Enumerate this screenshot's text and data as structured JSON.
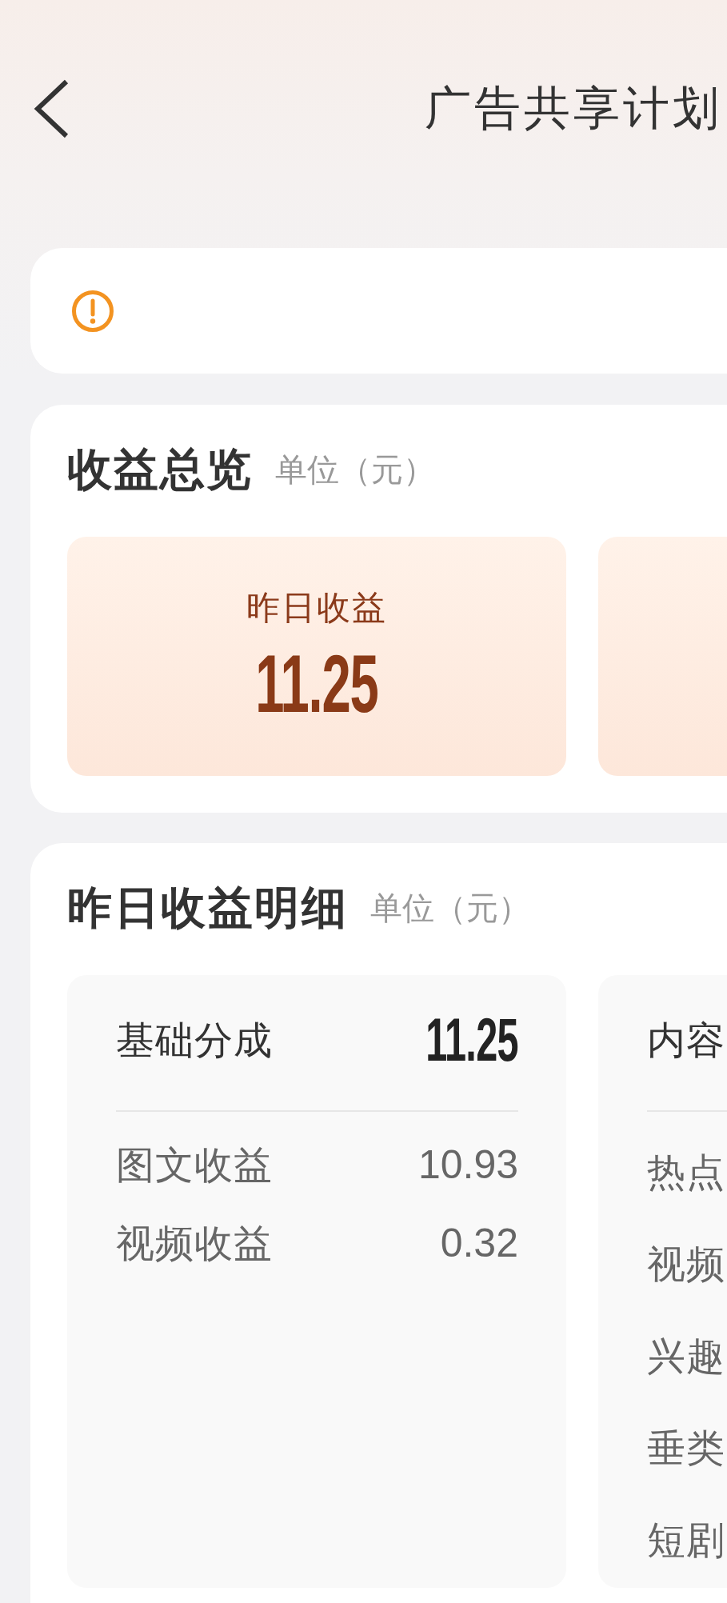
{
  "header": {
    "title": "广告共享计划"
  },
  "overview": {
    "title": "收益总览",
    "unit": "单位（元）",
    "tiles": [
      {
        "label": "昨日收益",
        "value": "11.25"
      }
    ]
  },
  "detail": {
    "title": "昨日收益明细",
    "unit": "单位（元）",
    "groups": [
      {
        "name": "基础分成",
        "total": "11.25",
        "items": [
          {
            "label": "图文收益",
            "value": "10.93"
          },
          {
            "label": "视频收益",
            "value": "0.32"
          }
        ]
      },
      {
        "name": "内容",
        "items": [
          {
            "label": "热点"
          },
          {
            "label": "视频"
          },
          {
            "label": "兴趣"
          },
          {
            "label": "垂类"
          },
          {
            "label": "短剧"
          }
        ]
      }
    ]
  }
}
